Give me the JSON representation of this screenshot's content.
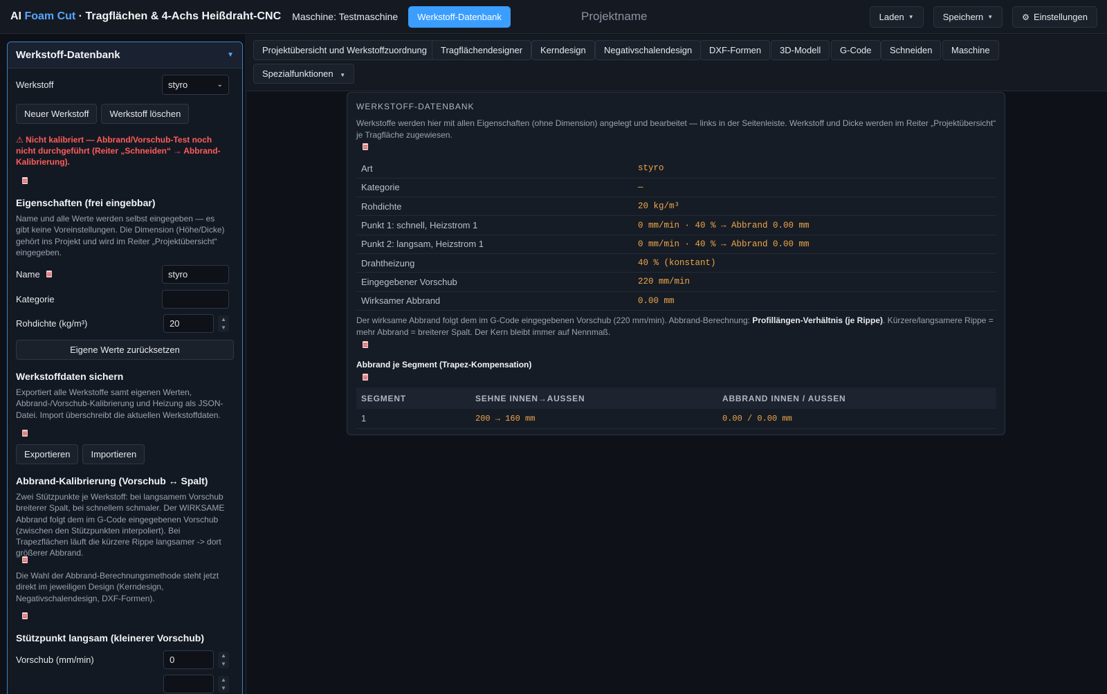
{
  "header": {
    "title_prefix": "AI ",
    "title_accent": "Foam Cut",
    "title_rest": " · Tragflächen & 4-Achs Heißdraht-CNC",
    "machine": "Maschine: Testmaschine",
    "active_tab": "Werkstoff-Datenbank",
    "project_name": "Projektname",
    "load": "Laden",
    "save": "Speichern",
    "settings": "Einstellungen"
  },
  "tabs": {
    "overview": "Projektübersicht und Werkstoffzuordnung",
    "wing_designer": "Tragflächendesigner",
    "core_design": "Kerndesign",
    "negative_shell": "Negativschalendesign",
    "dxf_shapes": "DXF-Formen",
    "model_3d": "3D-Modell",
    "gcode": "G-Code",
    "cutting": "Schneiden",
    "machine": "Maschine",
    "special": "Spezialfunktionen"
  },
  "sidebar": {
    "panel_title": "Werkstoff-Datenbank",
    "material_label": "Werkstoff",
    "material_value": "styro",
    "new_material": "Neuer Werkstoff",
    "delete_material": "Werkstoff löschen",
    "warning": "⚠ Nicht kalibriert — Abbrand/Vorschub-Test noch nicht durchgeführt (Reiter „Schneiden“ → Abbrand-Kalibrierung).",
    "properties_title": "Eigenschaften (frei eingebbar)",
    "properties_desc": "Name und alle Werte werden selbst eingegeben — es gibt keine Voreinstellungen. Die Dimension (Höhe/Dicke) gehört ins Projekt und wird im Reiter „Projektübersicht“ eingegeben.",
    "name_label": "Name",
    "name_value": "styro",
    "category_label": "Kategorie",
    "category_value": "",
    "density_label": "Rohdichte (kg/m³)",
    "density_value": "20",
    "reset_button": "Eigene Werte zurücksetzen",
    "backup_title": "Werkstoffdaten sichern",
    "backup_desc": "Exportiert alle Werkstoffe samt eigenen Werten, Abbrand-/Vorschub-Kalibrierung und Heizung als JSON-Datei. Import überschreibt die aktuellen Werkstoffdaten.",
    "export": "Exportieren",
    "import": "Importieren",
    "calib_title": "Abbrand-Kalibrierung (Vorschub ↔ Spalt)",
    "calib_desc": "Zwei Stützpunkte je Werkstoff: bei langsamem Vorschub breiterer Spalt, bei schnellem schmaler. Der WIRKSAME Abbrand folgt dem im G-Code eingegebenen Vorschub (zwischen den Stützpunkten interpoliert). Bei Trapezflächen läuft die kürzere Rippe langsamer -> dort größerer Abbrand.",
    "method_desc": "Die Wahl der Abbrand-Berechnungsmethode steht jetzt direkt im jeweiligen Design (Kerndesign, Negativschalendesign, DXF-Formen).",
    "slow_title": "Stützpunkt langsam (kleinerer Vorschub)",
    "feed_label": "Vorschub (mm/min)",
    "feed_value": "0"
  },
  "card": {
    "title": "WERKSTOFF-DATENBANK",
    "desc": "Werkstoffe werden hier mit allen Eigenschaften (ohne Dimension) angelegt und bearbeitet — links in der Seitenleiste. Werkstoff und Dicke werden im Reiter „Projektübersicht“ je Tragfläche zugewiesen.",
    "props": [
      {
        "k": "Art",
        "v": "styro"
      },
      {
        "k": "Kategorie",
        "v": "—"
      },
      {
        "k": "Rohdichte",
        "v": "20 kg/m³"
      },
      {
        "k": "Punkt 1: schnell, Heizstrom 1",
        "v": "0 mm/min · 40 % → Abbrand 0.00 mm"
      },
      {
        "k": "Punkt 2: langsam, Heizstrom 1",
        "v": "0 mm/min · 40 % → Abbrand 0.00 mm"
      },
      {
        "k": "Drahtheizung",
        "v": "40 % (konstant)"
      },
      {
        "k": "Eingegebener Vorschub",
        "v": "220 mm/min"
      },
      {
        "k": "Wirksamer Abbrand",
        "v": "0.00 mm"
      }
    ],
    "note_pre": "Der wirksame Abbrand folgt dem im G-Code eingegebenen Vorschub (220 mm/min). Abbrand-Berechnung: ",
    "note_bold": "Profillängen-Verhältnis (je Rippe)",
    "note_post": ". Kürzere/langsamere Rippe = mehr Abbrand = breiterer Spalt. Der Kern bleibt immer auf Nennmaß.",
    "segment_title": "Abbrand je Segment (Trapez-Kompensation)",
    "seg_headers": [
      "SEGMENT",
      "SEHNE INNEN→AUSSEN",
      "ABBRAND INNEN / AUSSEN"
    ],
    "seg_rows": [
      {
        "segment": "1",
        "chord": "200 → 160 mm",
        "burn": "0.00 / 0.00 mm"
      }
    ]
  }
}
